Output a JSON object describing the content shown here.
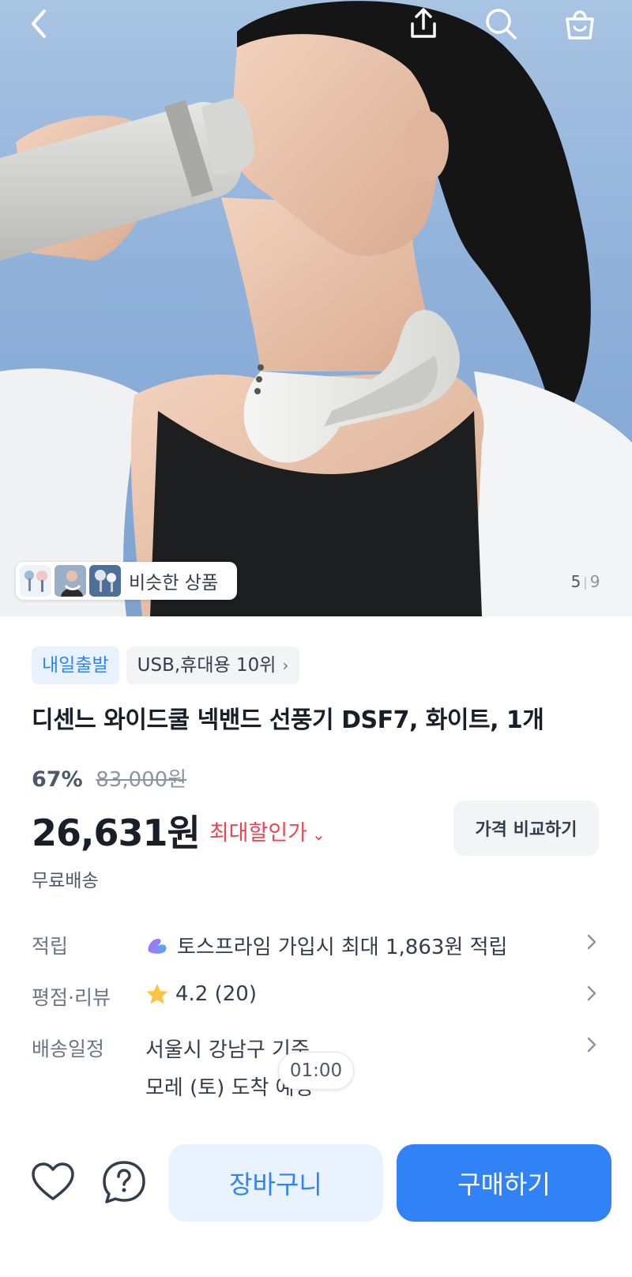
{
  "header": {
    "back_icon": "chevron-left-icon",
    "share_icon": "share-icon",
    "search_icon": "search-icon",
    "cart_icon": "shopping-bag-icon"
  },
  "gallery": {
    "similar_label": "비슷한 상품",
    "current": "5",
    "separator": "|",
    "total": "9"
  },
  "product": {
    "tags": {
      "delivery": "내일출발",
      "rank": "USB,휴대용 10위"
    },
    "title": "디센느 와이드쿨 넥밴드 선풍기 DSF7, 화이트, 1개",
    "discount_rate": "67%",
    "original_price": "83,000원",
    "price": "26,631원",
    "max_discount_label": "최대할인가",
    "compare_label": "가격 비교하기",
    "shipping_fee": "무료배송"
  },
  "info": {
    "points_key": "적립",
    "points_value": "토스프라임 가입시 최대 1,863원 적립",
    "rating_key": "평점·리뷰",
    "rating_value": "4.2 (20)",
    "shipping_key": "배송일정",
    "shipping_line1": "서울시 강남구 기준",
    "shipping_line2": "모레 (토) 도착 예정",
    "timer": "01:00"
  },
  "bottom_bar": {
    "like_icon": "heart-icon",
    "help_icon": "question-icon",
    "cart_label": "장바구니",
    "buy_label": "구매하기"
  },
  "colors": {
    "primary": "#3182f6",
    "primary_light": "#e8f3ff",
    "sale_red": "#f04452",
    "text_main": "#191f28",
    "text_sub": "#6b7684"
  }
}
